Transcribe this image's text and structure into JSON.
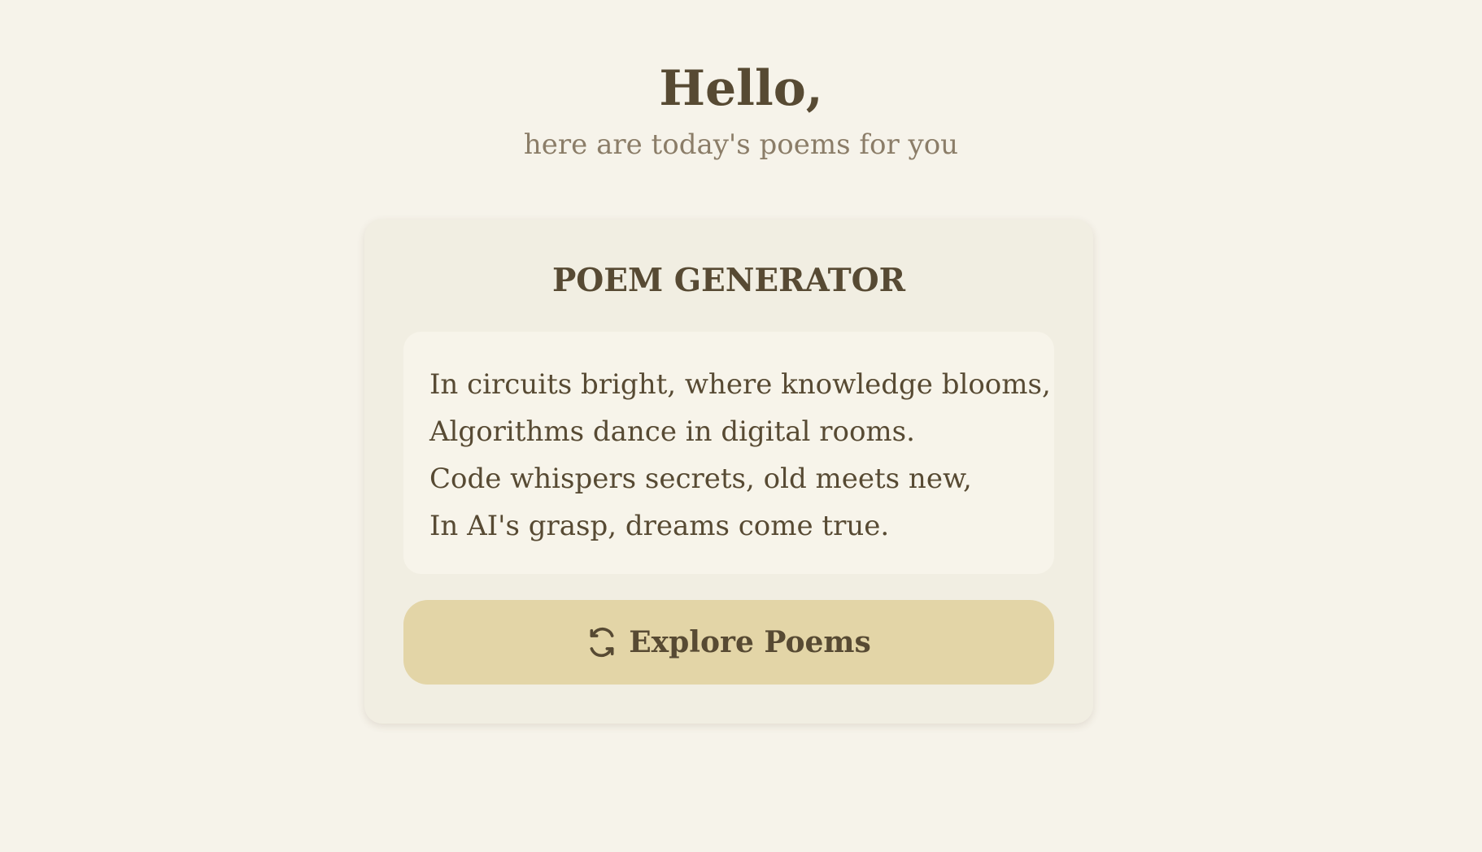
{
  "header": {
    "greeting": "Hello,",
    "subtitle": "here are today's poems for you"
  },
  "card": {
    "title": "POEM GENERATOR",
    "poem_lines": [
      "In circuits bright, where knowledge blooms,",
      "Algorithms dance in digital rooms.",
      "Code whispers secrets, old meets new,",
      "In AI's grasp, dreams come true."
    ],
    "button": {
      "label": "Explore Poems",
      "icon": "refresh-icon"
    }
  },
  "colors": {
    "background": "#f6f3ea",
    "card_background": "#f1eee2",
    "poem_background": "#f7f4ea",
    "button_background": "#e3d5a7",
    "text": "#574a33",
    "muted_text": "#8b7d68"
  }
}
